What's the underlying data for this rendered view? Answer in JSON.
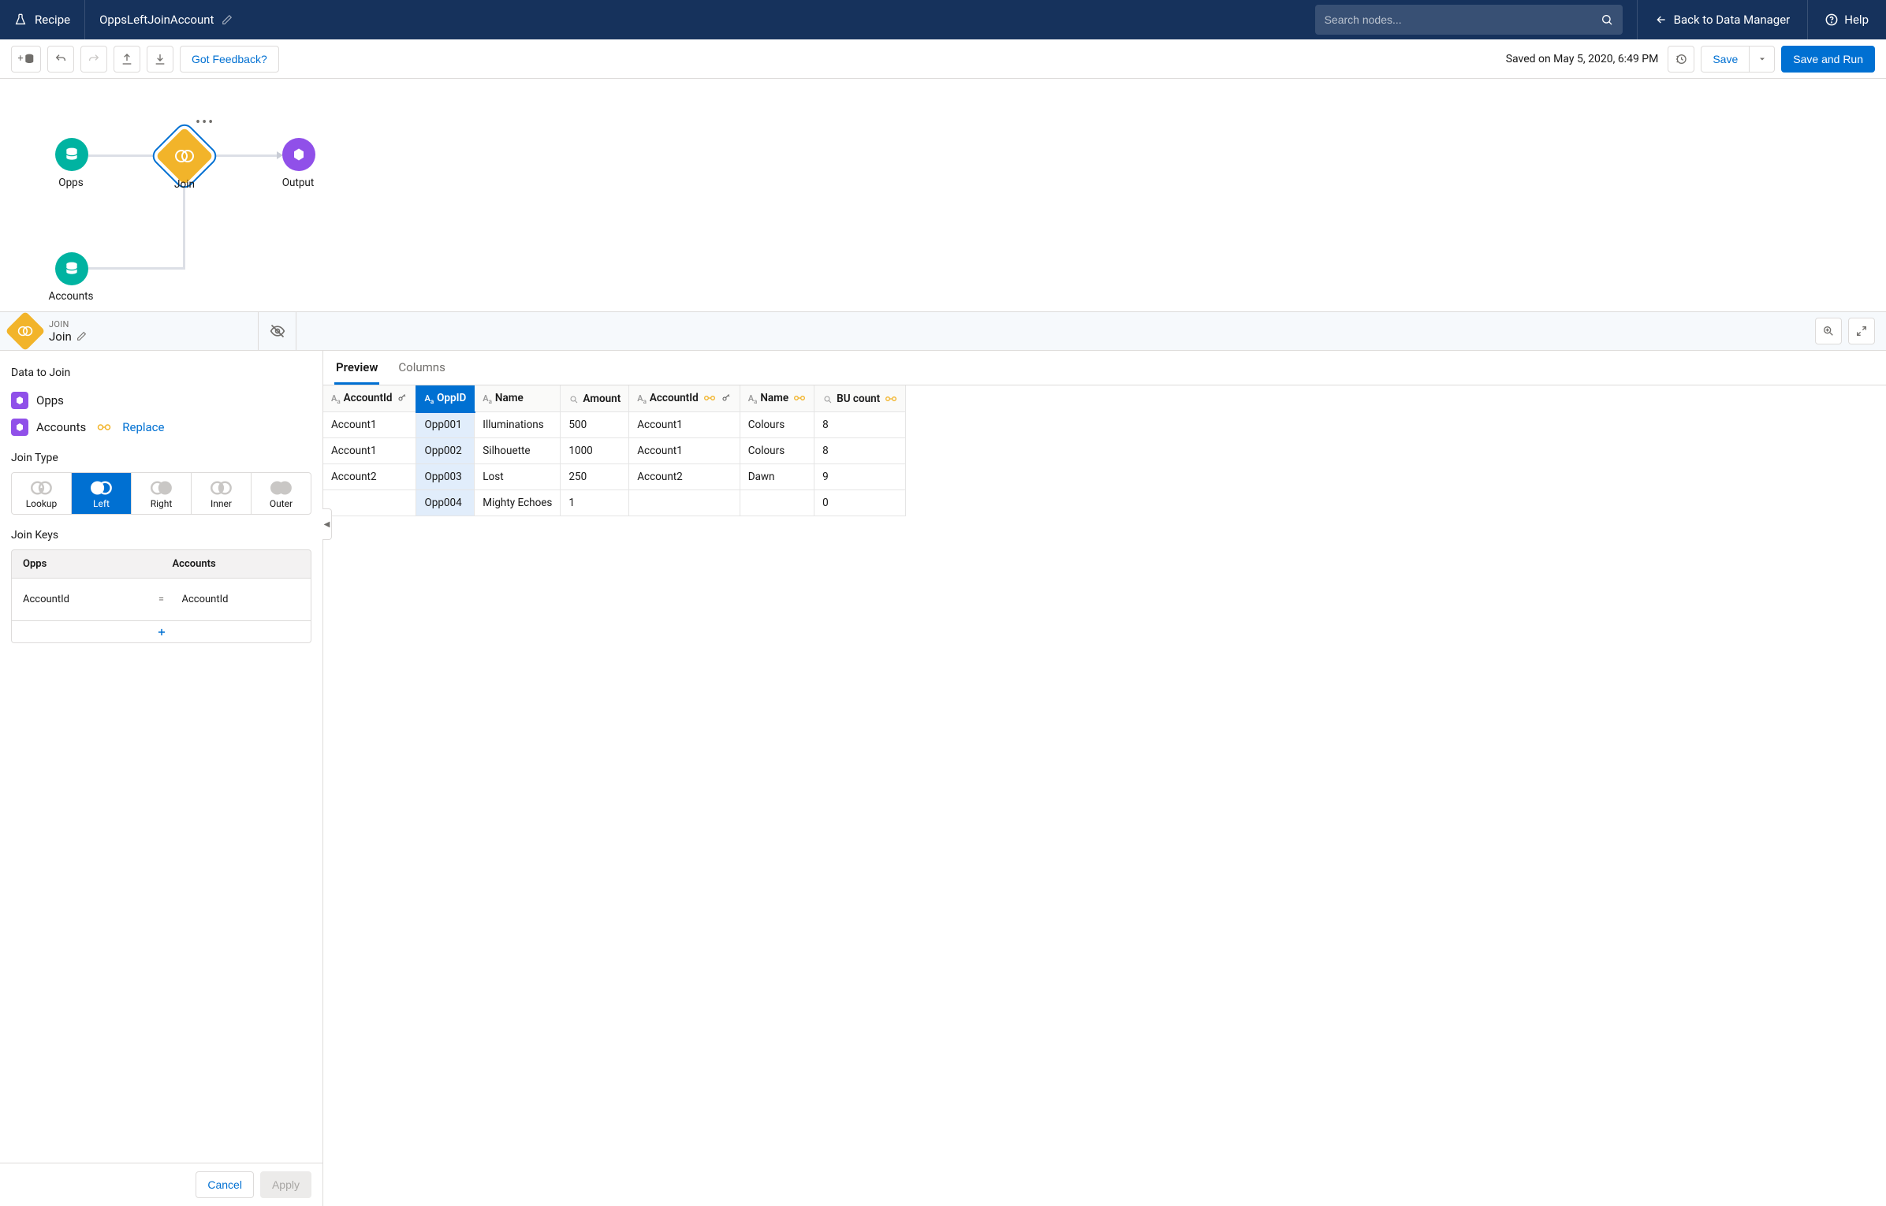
{
  "header": {
    "brand": "Recipe",
    "title": "OppsLeftJoinAccount",
    "search_placeholder": "Search nodes...",
    "back_label": "Back to Data Manager",
    "help_label": "Help"
  },
  "toolbar": {
    "feedback": "Got Feedback?",
    "saved_text": "Saved on May 5, 2020, 6:49 PM",
    "save": "Save",
    "save_run": "Save and Run"
  },
  "canvas": {
    "nodes": {
      "opps": "Opps",
      "accounts": "Accounts",
      "join": "Join",
      "output": "Output"
    }
  },
  "panel": {
    "type_label": "JOIN",
    "name": "Join",
    "sections": {
      "data_to_join": "Data to Join",
      "join_type": "Join Type",
      "join_keys": "Join Keys"
    },
    "data_items": [
      {
        "label": "Opps",
        "external": false
      },
      {
        "label": "Accounts",
        "external": true,
        "replace": "Replace"
      }
    ],
    "join_types": [
      {
        "key": "lookup",
        "label": "Lookup"
      },
      {
        "key": "left",
        "label": "Left"
      },
      {
        "key": "right",
        "label": "Right"
      },
      {
        "key": "inner",
        "label": "Inner"
      },
      {
        "key": "outer",
        "label": "Outer"
      }
    ],
    "join_type_active": "left",
    "keys_header": {
      "left": "Opps",
      "right": "Accounts"
    },
    "keys": [
      {
        "left": "AccountId",
        "right": "AccountId"
      }
    ],
    "buttons": {
      "cancel": "Cancel",
      "apply": "Apply"
    }
  },
  "preview": {
    "tabs": {
      "preview": "Preview",
      "columns": "Columns"
    },
    "active_tab": "preview",
    "columns": [
      {
        "key": "AccountId",
        "label": "AccountId",
        "type": "text",
        "side": "left",
        "is_key": true
      },
      {
        "key": "OppID",
        "label": "OppID",
        "type": "text",
        "side": "left",
        "is_key": false,
        "selected": true
      },
      {
        "key": "Name_l",
        "label": "Name",
        "type": "text",
        "side": "left",
        "is_key": false
      },
      {
        "key": "Amount",
        "label": "Amount",
        "type": "number",
        "side": "left",
        "is_key": false
      },
      {
        "key": "AccountId_r",
        "label": "AccountId",
        "type": "text",
        "side": "right",
        "is_key": true
      },
      {
        "key": "Name_r",
        "label": "Name",
        "type": "text",
        "side": "right",
        "is_key": false
      },
      {
        "key": "BU_count",
        "label": "BU count",
        "type": "number",
        "side": "right",
        "is_key": false
      }
    ],
    "rows": [
      {
        "AccountId": "Account1",
        "OppID": "Opp001",
        "Name_l": "Illuminations",
        "Amount": "500",
        "AccountId_r": "Account1",
        "Name_r": "Colours",
        "BU_count": "8"
      },
      {
        "AccountId": "Account1",
        "OppID": "Opp002",
        "Name_l": "Silhouette",
        "Amount": "1000",
        "AccountId_r": "Account1",
        "Name_r": "Colours",
        "BU_count": "8"
      },
      {
        "AccountId": "Account2",
        "OppID": "Opp003",
        "Name_l": "Lost",
        "Amount": "250",
        "AccountId_r": "Account2",
        "Name_r": "Dawn",
        "BU_count": "9"
      },
      {
        "AccountId": "",
        "OppID": "Opp004",
        "Name_l": "Mighty Echoes",
        "Amount": "1",
        "AccountId_r": "",
        "Name_r": "",
        "BU_count": "0"
      }
    ]
  }
}
